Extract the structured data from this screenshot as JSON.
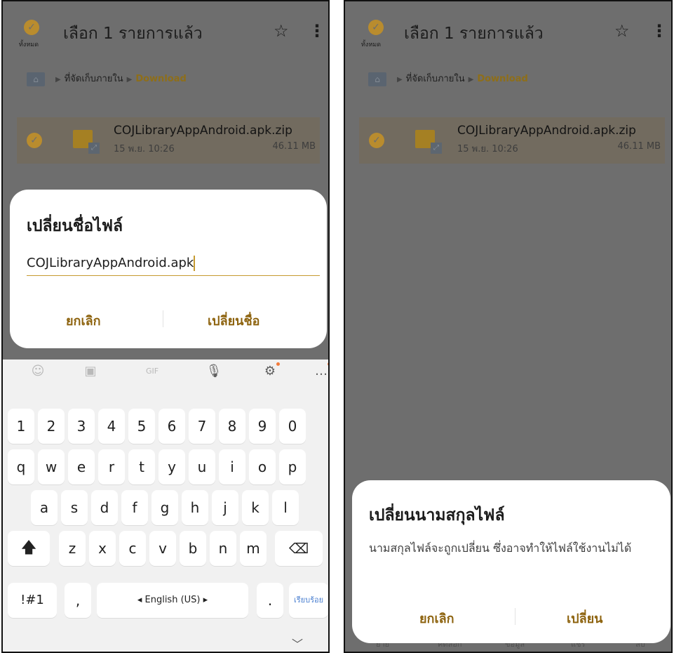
{
  "left": {
    "header": {
      "select_all_label": "ทั้งหมด",
      "title": "เลือก 1 รายการแล้ว",
      "star_icon": "☆",
      "more_icon": "⋮"
    },
    "breadcrumb": {
      "storage": "ที่จัดเก็บภายใน",
      "folder": "Download"
    },
    "file": {
      "name": "COJLibraryAppAndroid.apk.zip",
      "date": "15 พ.ย. 10:26",
      "size": "46.11 MB"
    },
    "rename_dialog": {
      "title": "เปลี่ยนชื่อไฟล์",
      "input_value": "COJLibraryAppAndroid.apk",
      "cancel": "ยกเลิก",
      "confirm": "เปลี่ยนชื่อ"
    },
    "keyboard": {
      "toolbar": [
        "emoji-icon",
        "sticker-icon",
        "gif-icon",
        "mic-icon",
        "settings-icon",
        "more-icon"
      ],
      "row_numbers": [
        "1",
        "2",
        "3",
        "4",
        "5",
        "6",
        "7",
        "8",
        "9",
        "0"
      ],
      "row1": [
        "q",
        "w",
        "e",
        "r",
        "t",
        "y",
        "u",
        "i",
        "o",
        "p"
      ],
      "row2": [
        "a",
        "s",
        "d",
        "f",
        "g",
        "h",
        "j",
        "k",
        "l"
      ],
      "row3": [
        "z",
        "x",
        "c",
        "v",
        "b",
        "n",
        "m"
      ],
      "symbols": "!#1",
      "comma": ",",
      "space": "◂ English (US) ▸",
      "period": ".",
      "done": "เรียบร้อย",
      "gif_label": "GIF",
      "collapse_icon": "﹀"
    }
  },
  "right": {
    "header": {
      "select_all_label": "ทั้งหมด",
      "title": "เลือก 1 รายการแล้ว",
      "star_icon": "☆",
      "more_icon": "⋮"
    },
    "breadcrumb": {
      "storage": "ที่จัดเก็บภายใน",
      "folder": "Download"
    },
    "file": {
      "name": "COJLibraryAppAndroid.apk.zip",
      "date": "15 พ.ย. 10:26",
      "size": "46.11 MB"
    },
    "extension_dialog": {
      "title": "เปลี่ยนนามสกุลไฟล์",
      "message": "นามสกุลไฟล์จะถูกเปลี่ยน ซึ่งอาจทำให้ไฟล์ใช้งานไม่ได้",
      "cancel": "ยกเลิก",
      "confirm": "เปลี่ยน"
    },
    "bottom_bar": [
      "ย้าย",
      "คัดลอก",
      "ข้อมูล",
      "แชร์",
      "ลบ"
    ]
  },
  "colors": {
    "accent": "#8e6410",
    "check": "#b98c2e",
    "dim": "#6e6e6e"
  }
}
